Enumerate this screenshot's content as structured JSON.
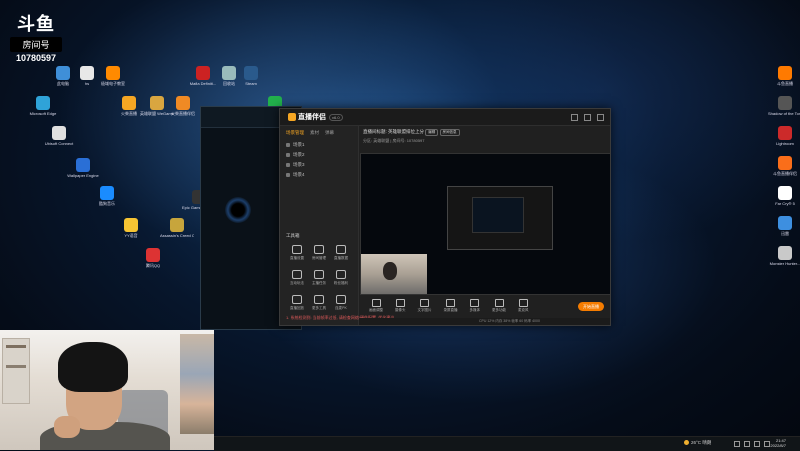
{
  "watermark": {
    "logo": "斗鱼",
    "sub": "房间号",
    "room_id": "10780597"
  },
  "desktop_left": [
    {
      "label": "此电脑",
      "color": "#3f8fd8"
    },
    {
      "label": "hs",
      "color": "#e8e8e8"
    },
    {
      "label": "极域电子教室",
      "color": "#ff8a00"
    },
    {
      "label": "Microsoft Edge",
      "color": "#2fa3d8"
    },
    {
      "label": "Ubisoft Connect",
      "color": "#e0e0e0"
    },
    {
      "label": "Wallpaper Engine",
      "color": "#2a6fd6"
    },
    {
      "label": "酷狗音乐",
      "color": "#1a8cff"
    },
    {
      "label": "YY语音",
      "color": "#f6c433"
    },
    {
      "label": "Assassin's Creed O...",
      "color": "#c7a53c"
    },
    {
      "label": "腾讯QQ",
      "color": "#d33"
    },
    {
      "label": "Epic Games Launcher",
      "color": "#333"
    },
    {
      "label": "火柴直播",
      "color": "#f5a623"
    },
    {
      "label": "英雄联盟 WeGame版",
      "color": "#d9a640"
    },
    {
      "label": "火柴直播伴侣",
      "color": "#f08a24"
    },
    {
      "label": "Mafia Definiti...",
      "color": "#c22"
    },
    {
      "label": "回收站",
      "color": "#9bb"
    },
    {
      "label": "Steam",
      "color": "#2a5a8c"
    },
    {
      "label": "微信",
      "color": "#22b14c"
    }
  ],
  "desktop_right": [
    {
      "label": "斗鱼直播",
      "color": "#ff7a00"
    },
    {
      "label": "Shadow of the Tom...",
      "color": "#555"
    },
    {
      "label": "Lightroom",
      "color": "#cc2a2a"
    },
    {
      "label": "斗鱼直播伴侣",
      "color": "#fa6e1a"
    },
    {
      "label": "Far Cry® 5",
      "color": "#ffffff"
    },
    {
      "label": "迅雷",
      "color": "#3d8fe0"
    },
    {
      "label": "Monster Hunter...",
      "color": "#c9c9c9"
    }
  ],
  "app": {
    "brand": "直播伴侣",
    "version": "v6.0",
    "tabs": [
      "场景管理",
      "素材",
      "弹幕"
    ],
    "scenes": [
      "场景1",
      "场景2",
      "场景3",
      "场景4"
    ],
    "tools_title": "工具箱",
    "tools": [
      {
        "label": "直播设置"
      },
      {
        "label": "房间管理"
      },
      {
        "label": "直播数据"
      },
      {
        "label": "互动玩法"
      },
      {
        "label": "主播任务"
      },
      {
        "label": "粉丝福利"
      },
      {
        "label": "直播回放"
      },
      {
        "label": "更多工具"
      },
      {
        "label": "连麦PK"
      }
    ],
    "warning": "1. 系统检测到: 当前帧率过低, 请检查网络/硬件配置, 优化建议",
    "room_title": "直播间标题: 英雄联盟排位上分",
    "room_edit": "编辑",
    "room_info_button": "房间信息",
    "room_meta": "分区: 英雄联盟 | 房间号: 10780597",
    "controls": [
      "画面调整",
      "摄像头",
      "文字图片",
      "录屏直播",
      "多媒体",
      "更多功能",
      "麦克风"
    ],
    "go_live": "开始直播",
    "status": "CPU 12%  内存 38%  帧率 60  码率 4000"
  },
  "taskbar": {
    "temperature": "26°C",
    "weather": "晴朗",
    "time": "21:47",
    "date": "2022/8/7"
  }
}
